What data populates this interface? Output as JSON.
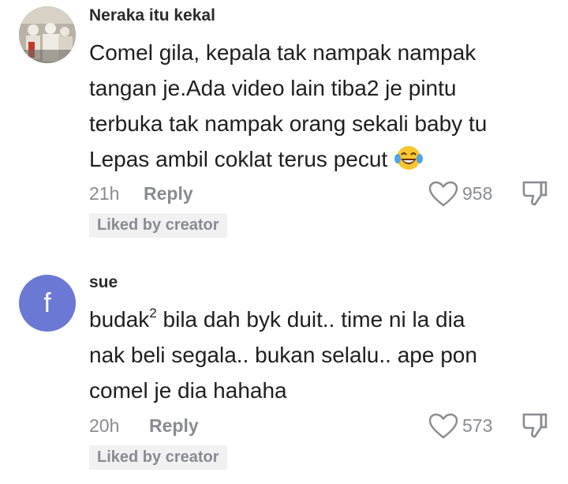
{
  "comments": [
    {
      "username": "Neraka itu kekal",
      "lines": [
        "Comel gila, kepala tak nampak nampak",
        "tangan je.Ada video lain tiba2 je pintu",
        "terbuka tak nampak orang sekali baby tu",
        "Lepas ambil coklat terus pecut"
      ],
      "emoji": "laughing-tears-emoji",
      "time": "21h",
      "reply_label": "Reply",
      "likes": "958",
      "badge": "Liked by creator",
      "avatar_icon": "profile-photo"
    },
    {
      "username": "sue",
      "avatar_letter": "f",
      "line1_base": "budak",
      "line1_sup": "2",
      "line1_rest": " bila dah byk duit.. time ni la dia",
      "lines_rest": [
        "nak beli segala.. bukan selalu.. ape pon",
        "comel je dia hahaha"
      ],
      "time": "20h",
      "reply_label": "Reply",
      "likes": "573",
      "badge": "Liked by creator"
    }
  ],
  "icons": {
    "heart": "heart-outline-icon",
    "dislike": "thumbs-down-icon"
  },
  "colors": {
    "accent_avatar": "#6b79d4",
    "muted": "#8a8b91",
    "badge_bg": "#f1f1f2"
  }
}
